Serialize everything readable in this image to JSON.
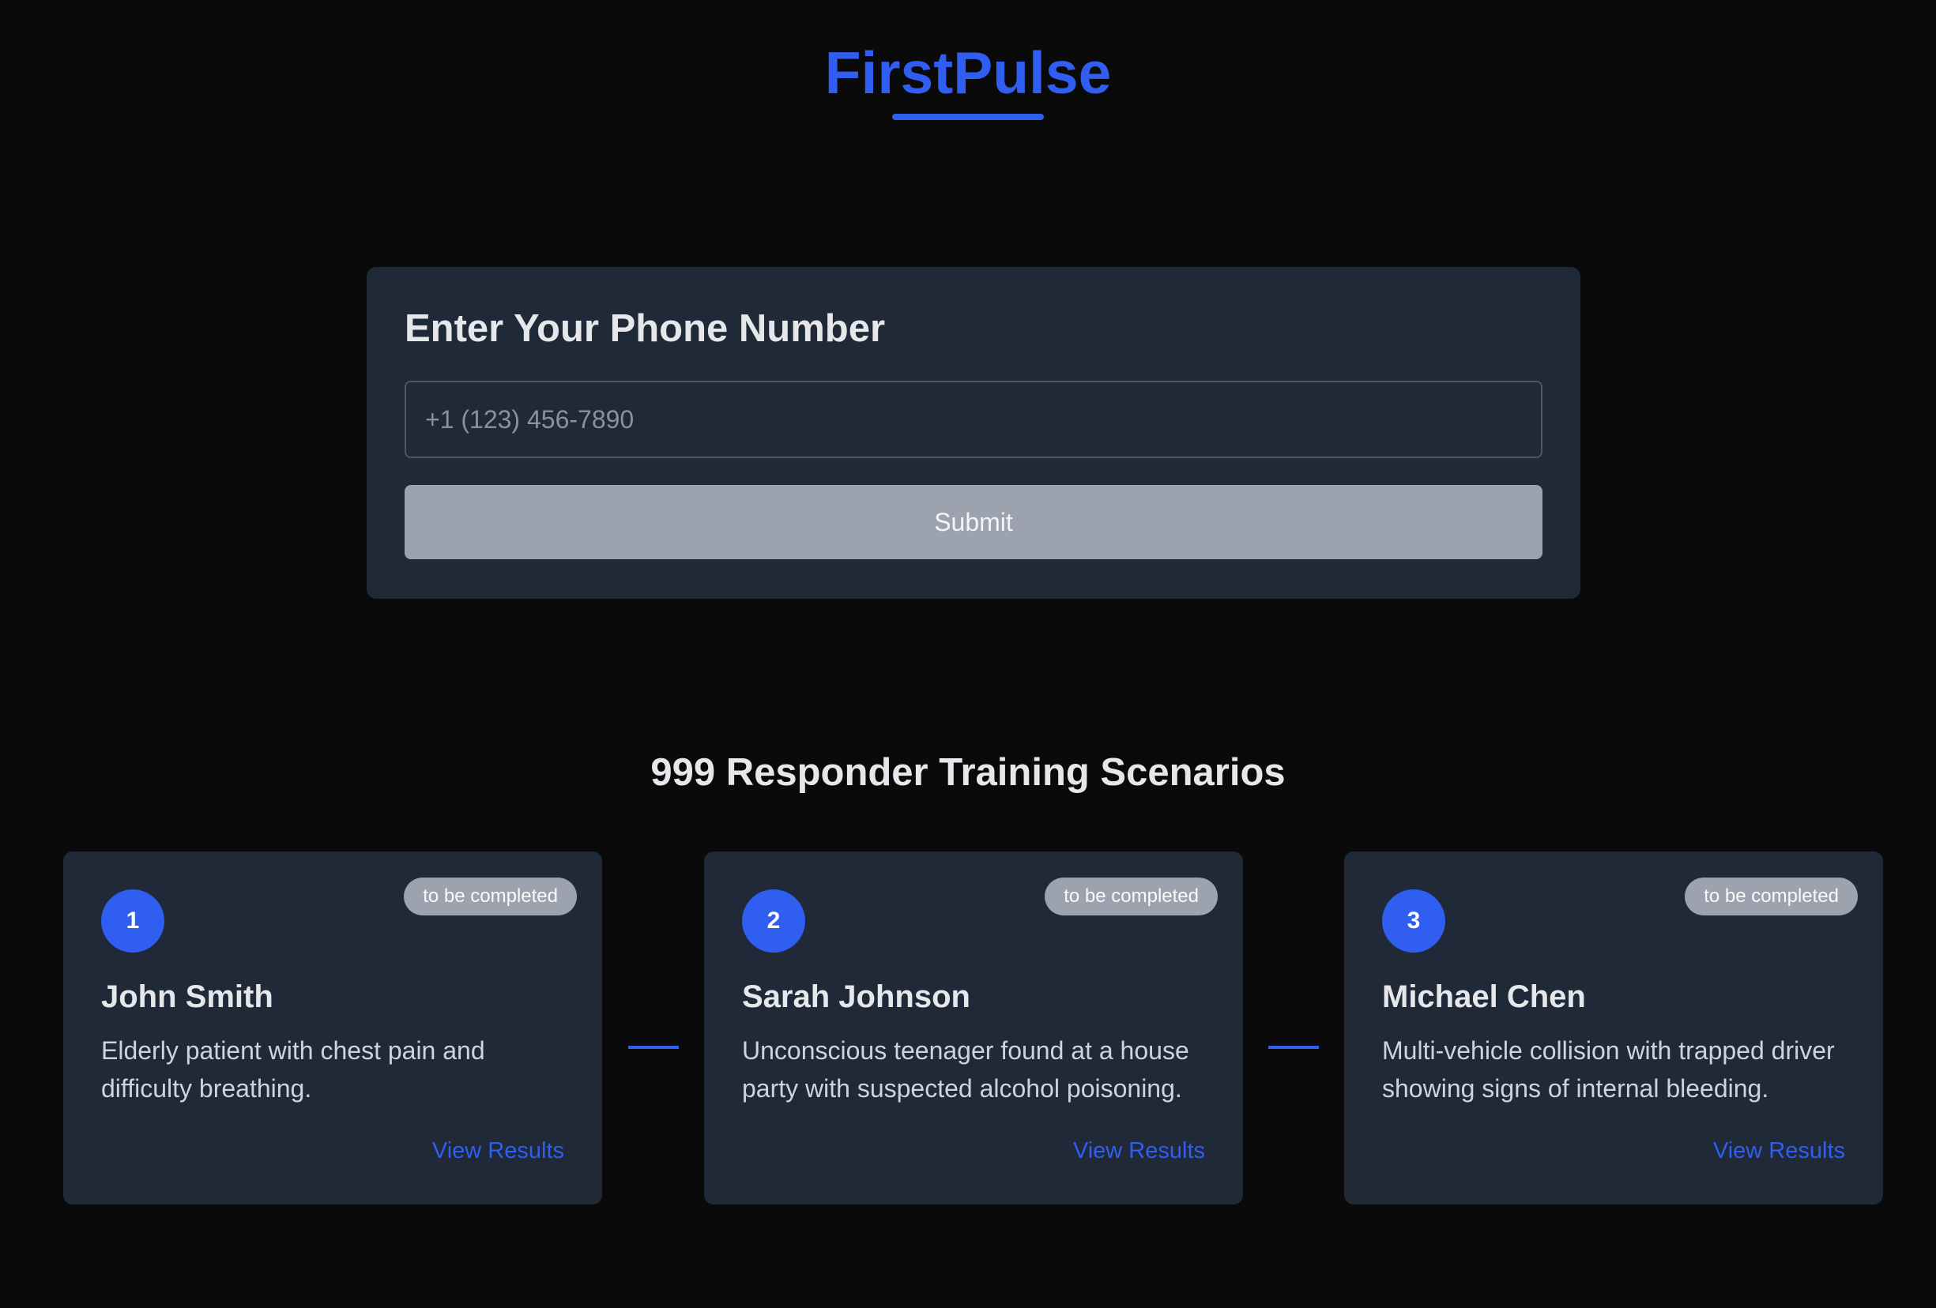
{
  "header": {
    "logo": "FirstPulse"
  },
  "phone_form": {
    "title": "Enter Your Phone Number",
    "input_placeholder": "+1 (123) 456-7890",
    "input_value": "",
    "submit_label": "Submit"
  },
  "scenarios": {
    "title": "999 Responder Training Scenarios",
    "items": [
      {
        "number": "1",
        "status": "to be completed",
        "name": "John Smith",
        "description": "Elderly patient with chest pain and difficulty breathing.",
        "link_label": "View Results"
      },
      {
        "number": "2",
        "status": "to be completed",
        "name": "Sarah Johnson",
        "description": "Unconscious teenager found at a house party with suspected alcohol poisoning.",
        "link_label": "View Results"
      },
      {
        "number": "3",
        "status": "to be completed",
        "name": "Michael Chen",
        "description": "Multi-vehicle collision with trapped driver showing signs of internal bleeding.",
        "link_label": "View Results"
      }
    ]
  },
  "colors": {
    "background": "#0a0a0a",
    "card": "#1f2937",
    "accent": "#2f5ef0",
    "muted_button": "#9ca3af",
    "text": "#e5e7eb"
  }
}
